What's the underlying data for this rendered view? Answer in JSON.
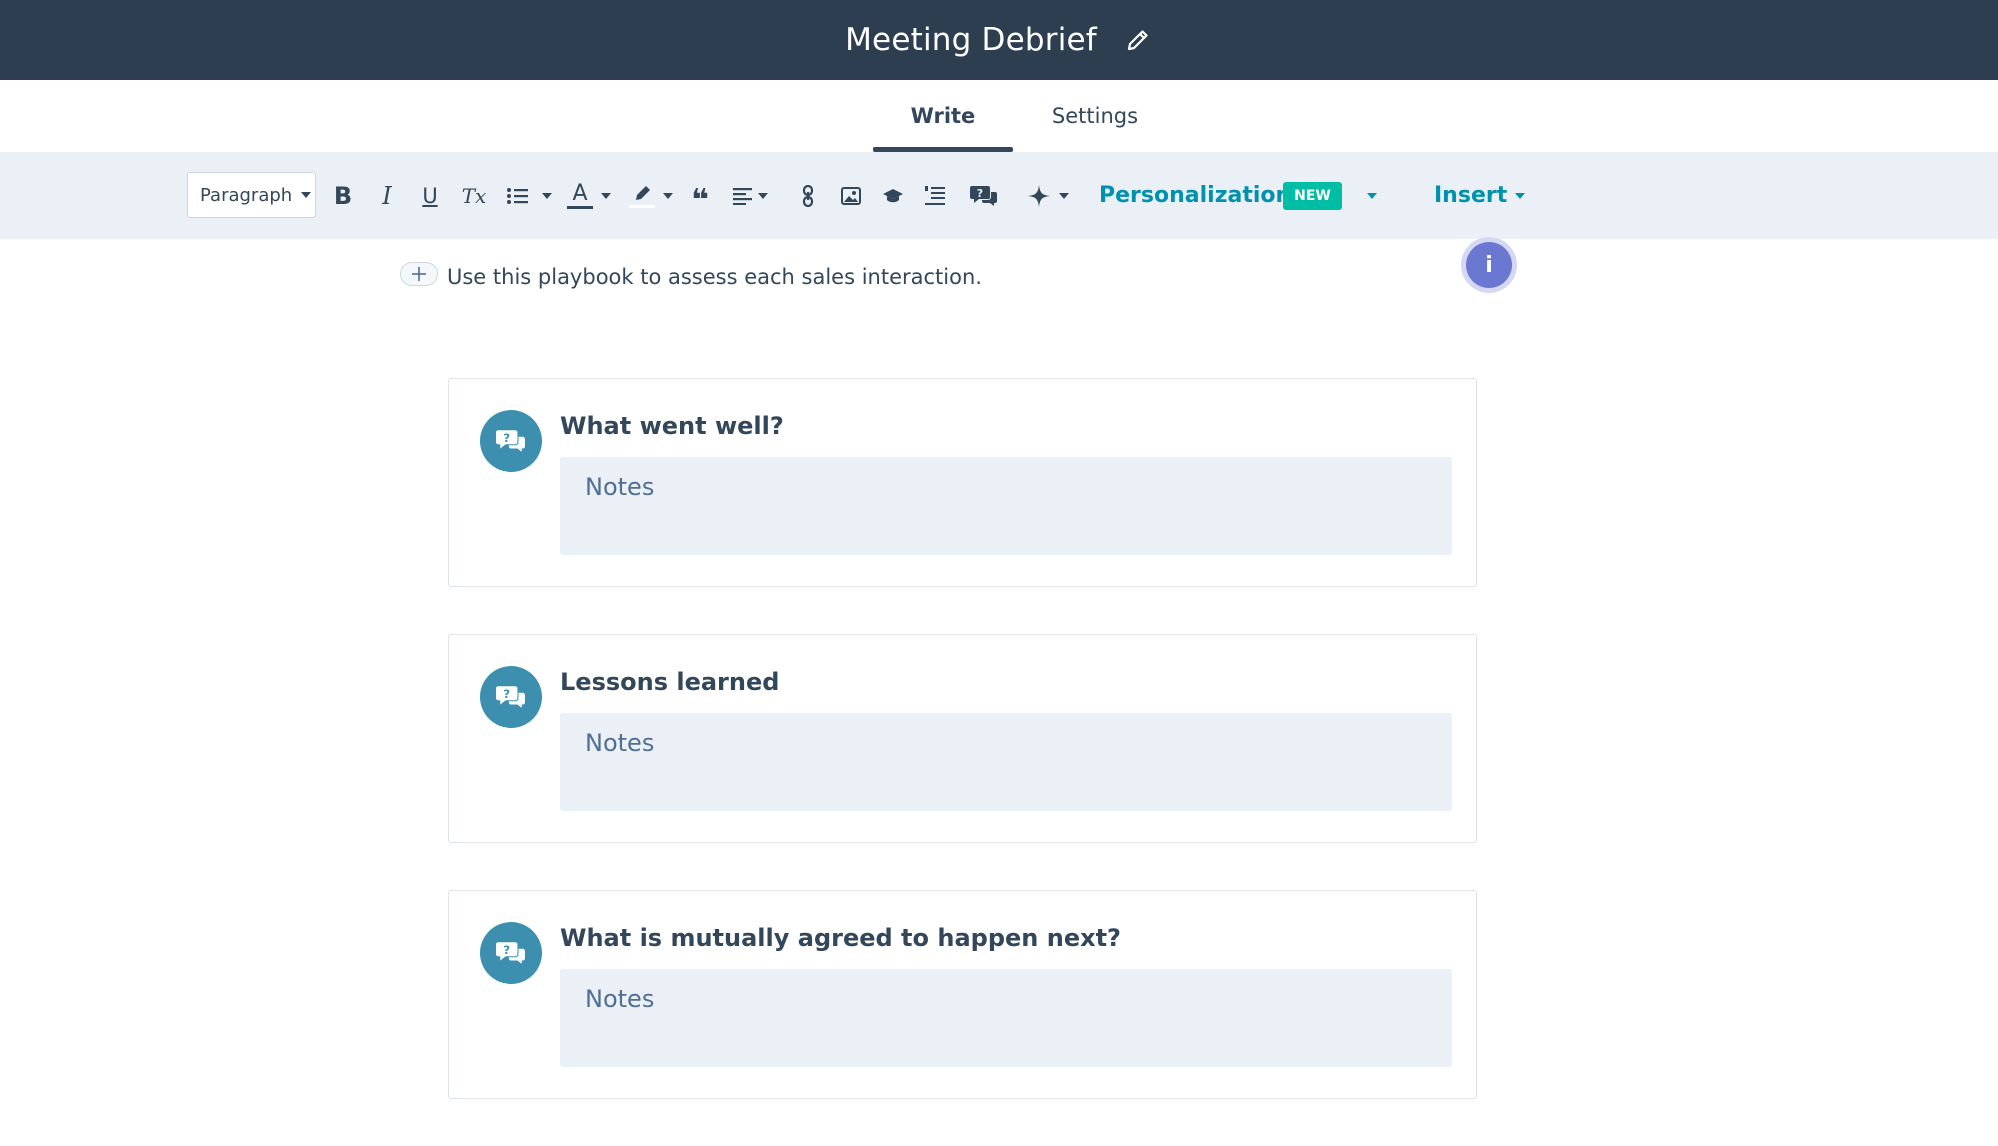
{
  "header": {
    "title": "Meeting Debrief",
    "edit_icon": "pencil-icon"
  },
  "tabs": [
    {
      "label": "Write",
      "active": true
    },
    {
      "label": "Settings",
      "active": false
    }
  ],
  "toolbar": {
    "paragraph_select": "Paragraph",
    "buttons": [
      {
        "name": "bold",
        "glyph": "B"
      },
      {
        "name": "italic",
        "glyph": "I"
      },
      {
        "name": "underline",
        "glyph": "U"
      },
      {
        "name": "clear-formatting",
        "glyph": "Tx"
      },
      {
        "name": "bulleted-list",
        "icon": "list-icon"
      },
      {
        "name": "text-color",
        "glyph": "A"
      },
      {
        "name": "highlight",
        "icon": "highlighter-icon"
      },
      {
        "name": "blockquote",
        "glyph": "❝"
      },
      {
        "name": "align",
        "icon": "align-left-icon"
      },
      {
        "name": "link",
        "icon": "link-icon"
      },
      {
        "name": "image",
        "icon": "image-icon"
      },
      {
        "name": "course",
        "icon": "mortarboard-icon"
      },
      {
        "name": "numbered-list",
        "icon": "list-numbered-icon"
      },
      {
        "name": "question",
        "icon": "question-bubble-icon"
      },
      {
        "name": "ai-assistant",
        "icon": "sparkle-icon"
      }
    ],
    "personalization_label": "Personalization",
    "new_badge": "NEW",
    "insert_label": "Insert"
  },
  "editor": {
    "intro_text": "Use this playbook to assess each sales interaction.",
    "info_bubble": "i",
    "questions": [
      {
        "label": "What went well?",
        "notes_placeholder": "Notes"
      },
      {
        "label": "Lessons learned",
        "notes_placeholder": "Notes"
      },
      {
        "label": "What is mutually agreed to happen next?",
        "notes_placeholder": "Notes"
      }
    ]
  },
  "colors": {
    "header_bg": "#2d3e50",
    "toolbar_bg": "#eaf0f6",
    "accent_teal": "#0091ae",
    "new_badge_bg": "#00bda5",
    "question_icon_bg": "#3d8fb0",
    "info_bubble": "#6a78d1"
  }
}
